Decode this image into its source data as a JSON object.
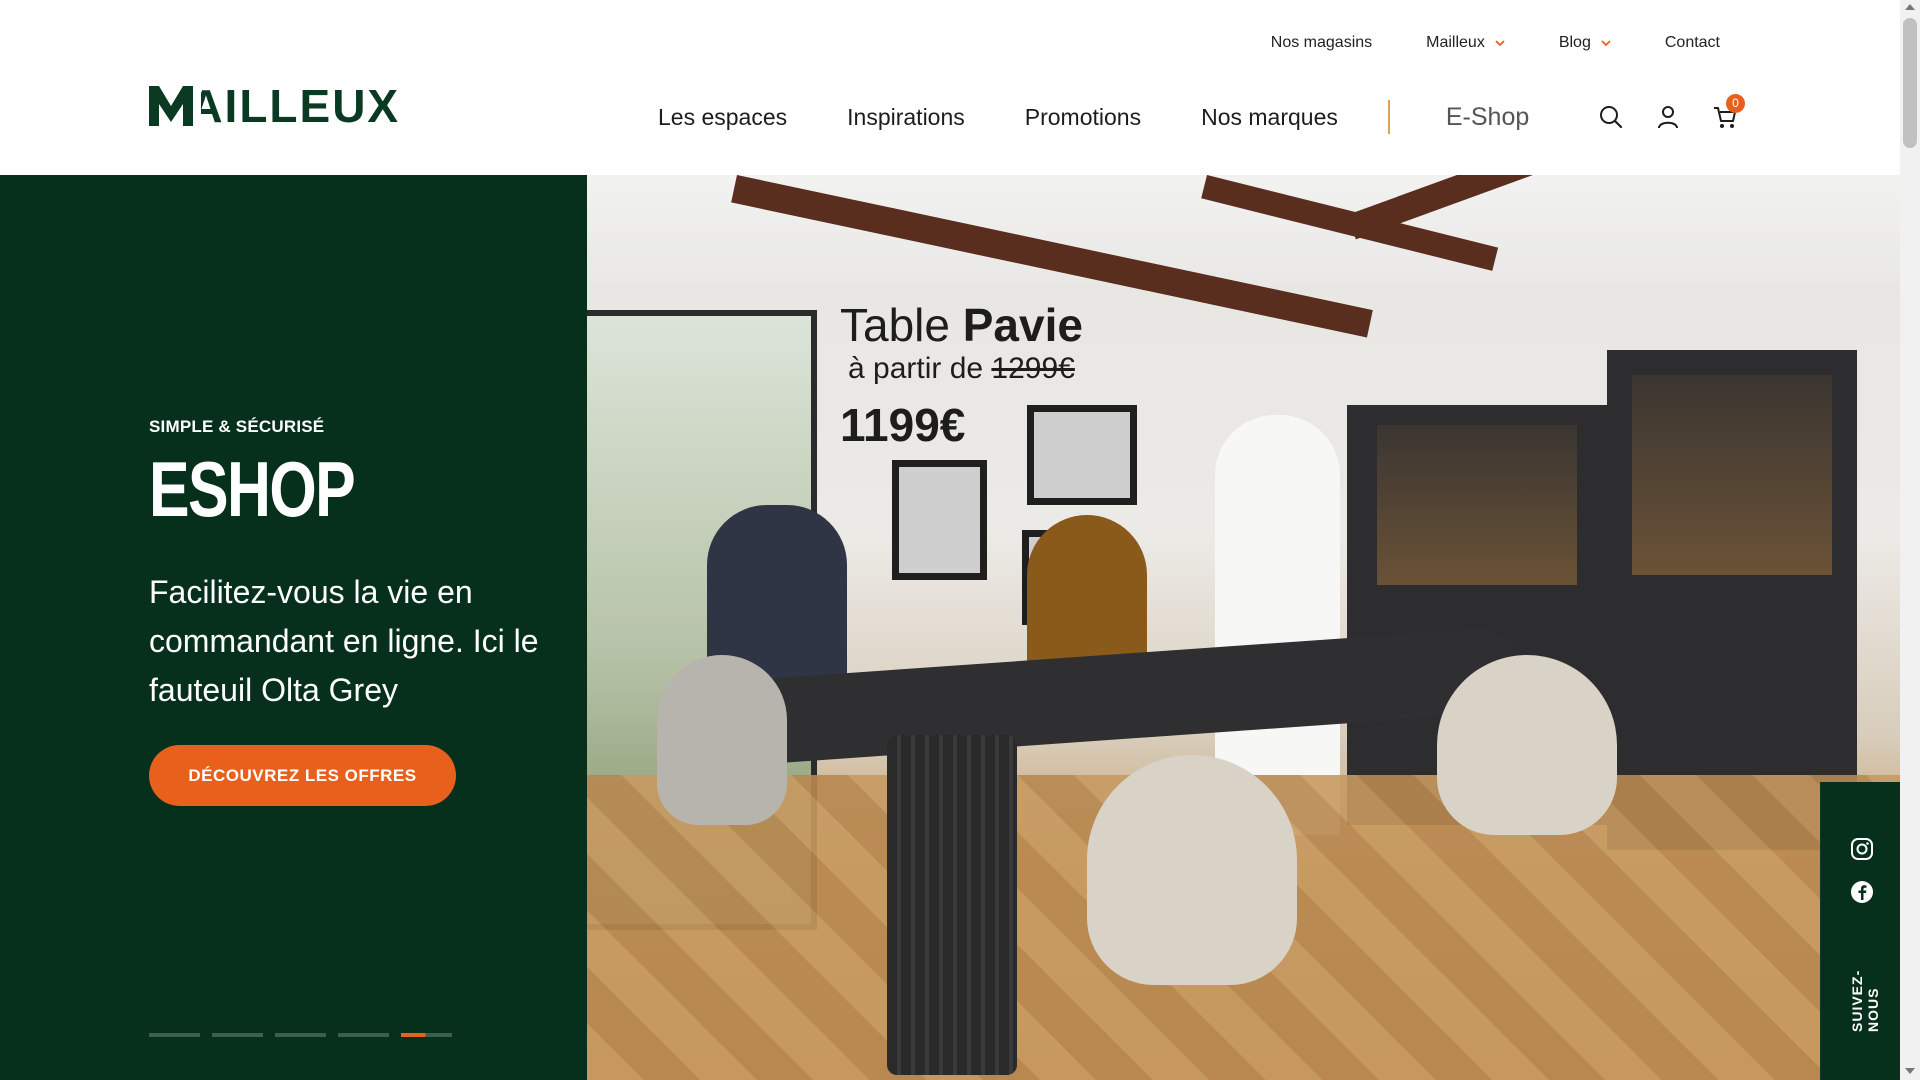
{
  "brand": {
    "logo_text": "MAILLEUX"
  },
  "top_nav": {
    "items": [
      {
        "label": "Nos magasins",
        "dropdown": false
      },
      {
        "label": "Mailleux",
        "dropdown": true
      },
      {
        "label": "Blog",
        "dropdown": true
      },
      {
        "label": "Contact",
        "dropdown": false
      }
    ]
  },
  "main_nav": {
    "items": [
      "Les espaces",
      "Inspirations",
      "Promotions",
      "Nos marques"
    ],
    "eshop_label": "E-Shop"
  },
  "header_icons": {
    "search": "search-icon",
    "account": "user-icon",
    "cart": "cart-icon",
    "cart_count": "0"
  },
  "hero": {
    "kicker": "SIMPLE & SÉCURISÉ",
    "title": "ESHOP",
    "description": "Facilitez-vous la vie en commandant en ligne. Ici le fauteuil Olta Grey",
    "cta_label": "DÉCOUVREZ LES OFFRES",
    "slides_total": 5,
    "active_slide": 5
  },
  "promo": {
    "title_prefix": "Table",
    "title_name": "Pavie",
    "from_label": "à partir de",
    "old_price": "1299€",
    "price": "1199€"
  },
  "social": {
    "icons": [
      "instagram-icon",
      "facebook-icon"
    ],
    "follow_label": "SUIVEZ-NOUS"
  },
  "colors": {
    "brand_green": "#06301c",
    "accent_orange": "#e8601c"
  }
}
